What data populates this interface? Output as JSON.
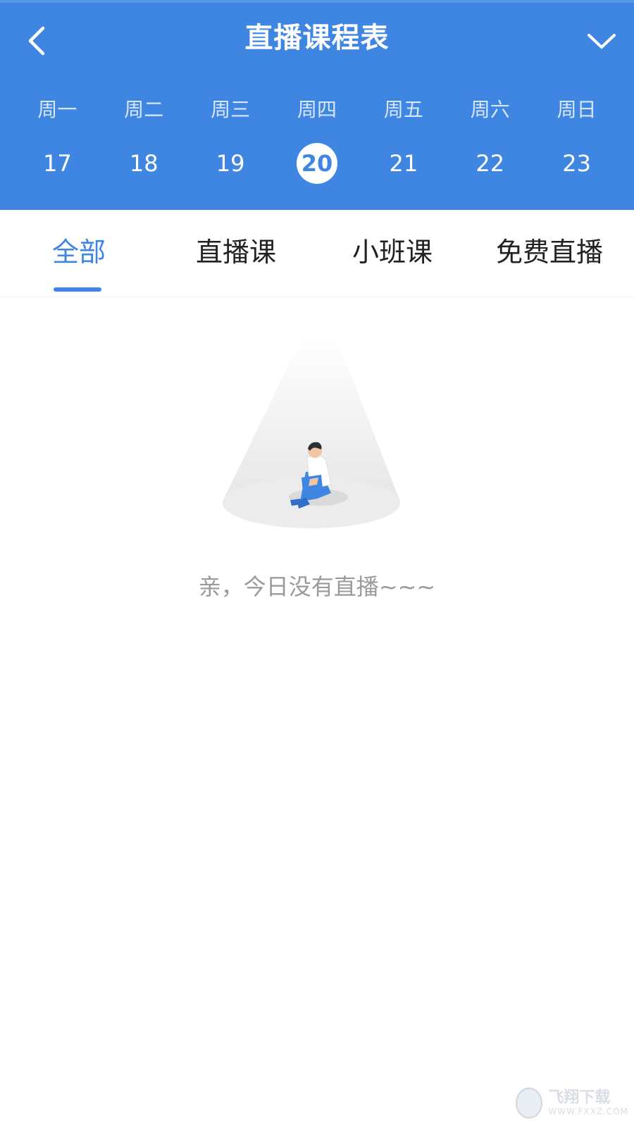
{
  "header": {
    "title": "直播课程表",
    "back_icon": "chevron-left-icon",
    "dropdown_icon": "chevron-down-icon",
    "background_color": "#3f86e2"
  },
  "calendar": {
    "weekdays": [
      "周一",
      "周二",
      "周三",
      "周四",
      "周五",
      "周六",
      "周日"
    ],
    "dates": [
      "17",
      "18",
      "19",
      "20",
      "21",
      "22",
      "23"
    ],
    "selected_date": "20"
  },
  "tabs": [
    {
      "label": "全部",
      "active": true
    },
    {
      "label": "直播课",
      "active": false
    },
    {
      "label": "小班课",
      "active": false
    },
    {
      "label": "免费直播",
      "active": false
    }
  ],
  "empty_state": {
    "message": "亲，今日没有直播~~~",
    "illustration": "person-sitting-under-spotlight"
  },
  "watermark": {
    "text_cn": "飞翔下载",
    "text_en": "WWW.FXXZ.COM"
  },
  "colors": {
    "accent": "#3f86e2",
    "muted_text": "#9a9a9a"
  }
}
